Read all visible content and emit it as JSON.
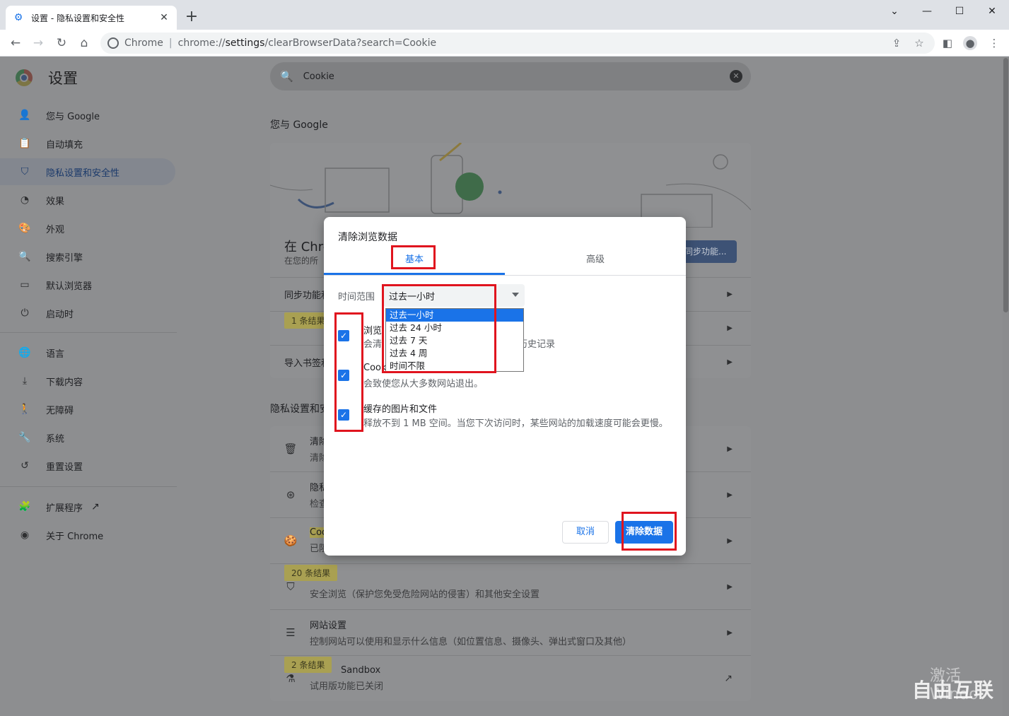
{
  "tab": {
    "title": "设置 - 隐私设置和安全性"
  },
  "omnibox": {
    "site_label": "Chrome",
    "url_prefix": "chrome://",
    "url_host": "settings",
    "url_path": "/clearBrowserData?search=Cookie"
  },
  "settings_title": "设置",
  "search": {
    "value": "Cookie"
  },
  "sidebar": {
    "items": [
      {
        "label": "您与 Google"
      },
      {
        "label": "自动填充"
      },
      {
        "label": "隐私设置和安全性"
      },
      {
        "label": "效果"
      },
      {
        "label": "外观"
      },
      {
        "label": "搜索引擎"
      },
      {
        "label": "默认浏览器"
      },
      {
        "label": "启动时"
      },
      {
        "label": "语言"
      },
      {
        "label": "下载内容"
      },
      {
        "label": "无障碍"
      },
      {
        "label": "系统"
      },
      {
        "label": "重置设置"
      },
      {
        "label": "扩展程序"
      },
      {
        "label": "关于 Chrome"
      }
    ]
  },
  "main": {
    "you_google_title": "您与 Google",
    "sync_heading": "在 Chro",
    "sync_sub": "在您的所",
    "sync_button": "同步功能...",
    "row_sync": "同步功能和",
    "row_import": "导入书签和",
    "badge_1": "1 条结果",
    "privacy_title": "隐私设置和安",
    "row_clear_t1": "清除",
    "row_clear_t2": "清除",
    "row_guide_t1": "隐私",
    "row_guide_t2": "检查",
    "row_cookie_t1": "Coo",
    "row_cookie_t2": "已阻",
    "badge_20": "20 条结果",
    "row_security_t2": "安全浏览（保护您免受危险网站的侵害）和其他安全设置",
    "row_site_t1": "网站设置",
    "row_site_t2": "控制网站可以使用和显示什么信息（如位置信息、摄像头、弹出式窗口及其他）",
    "badge_2": "2 条结果",
    "row_sandbox_t1": "Sandbox",
    "row_sandbox_t2": "试用版功能已关闭"
  },
  "dialog": {
    "title": "清除浏览数据",
    "tab_basic": "基本",
    "tab_advanced": "高级",
    "range_label": "时间范围",
    "range_value": "过去一小时",
    "options": [
      "过去一小时",
      "过去 24 小时",
      "过去 7 天",
      "过去 4 周",
      "时间不限"
    ],
    "history_t1": "浏览",
    "history_t2": "会清",
    "history_tail": "历史记录",
    "cookies_t1": "Cook",
    "cookies_t2": "会致使您从大多数网站退出。",
    "cache_t1": "缓存的图片和文件",
    "cache_t2": "释放不到 1 MB 空间。当您下次访问时，某些网站的加载速度可能会更慢。",
    "cancel": "取消",
    "clear": "清除数据"
  },
  "watermark": {
    "activate": "激活 Windo",
    "brand": "自由互联"
  },
  "colors": {
    "accent": "#1a73e8",
    "highlight": "#e0141e"
  }
}
